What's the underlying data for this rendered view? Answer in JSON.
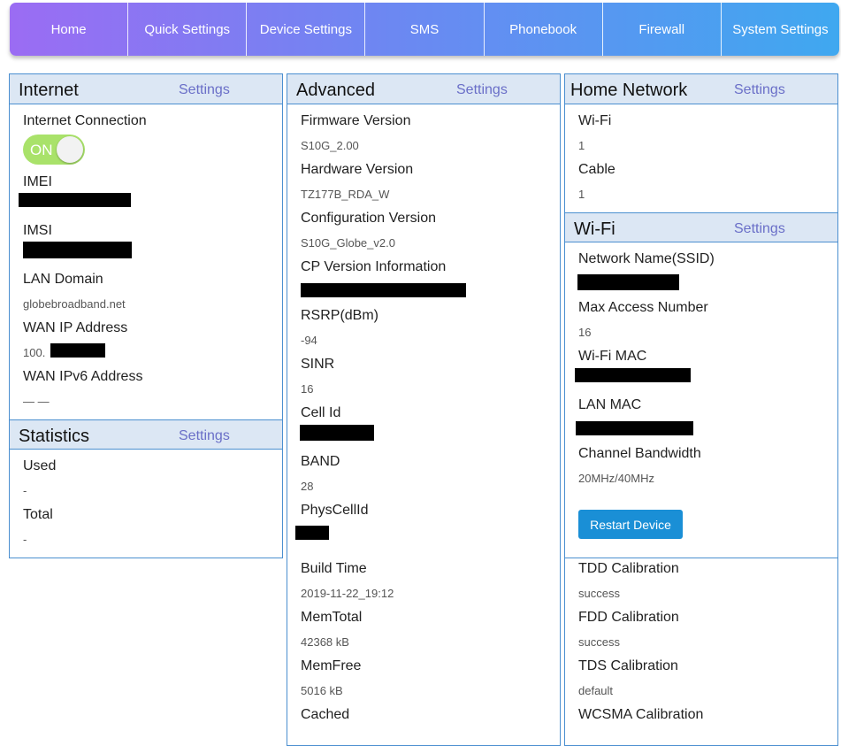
{
  "nav": [
    "Home",
    "Quick Settings",
    "Device Settings",
    "SMS",
    "Phonebook",
    "Firewall",
    "System Settings"
  ],
  "internet": {
    "title": "Internet",
    "settings": "Settings",
    "connection_label": "Internet Connection",
    "toggle": "ON",
    "imei_label": "IMEI",
    "imsi_label": "IMSI",
    "lan_domain_label": "LAN Domain",
    "lan_domain": "globebroadband.net",
    "wan_ip_label": "WAN IP Address",
    "wan_ip_prefix": "100.",
    "wan_ipv6_label": "WAN IPv6 Address",
    "wan_ipv6": "— —"
  },
  "statistics": {
    "title": "Statistics",
    "settings": "Settings",
    "used_label": "Used",
    "used": "-",
    "total_label": "Total",
    "total": "-"
  },
  "advanced": {
    "title": "Advanced",
    "settings": "Settings",
    "items": [
      {
        "label": "Firmware Version",
        "value": "S10G_2.00"
      },
      {
        "label": "Hardware Version",
        "value": "TZ177B_RDA_W"
      },
      {
        "label": "Configuration Version",
        "value": "S10G_Globe_v2.0"
      },
      {
        "label": "CP Version Information",
        "value": ""
      },
      {
        "label": "RSRP(dBm)",
        "value": "-94"
      },
      {
        "label": "SINR",
        "value": "16"
      },
      {
        "label": "Cell Id",
        "value": ""
      },
      {
        "label": "BAND",
        "value": "28"
      },
      {
        "label": "PhysCellId",
        "value": ""
      },
      {
        "label": "Build Time",
        "value": "2019-11-22_19:12"
      },
      {
        "label": "MemTotal",
        "value": "42368 kB"
      },
      {
        "label": "MemFree",
        "value": "5016 kB"
      },
      {
        "label": "Cached",
        "value": ""
      }
    ]
  },
  "home_network": {
    "title": "Home Network",
    "settings": "Settings",
    "wifi_label": "Wi-Fi",
    "wifi": "1",
    "cable_label": "Cable",
    "cable": "1"
  },
  "wifi": {
    "title": "Wi-Fi",
    "settings": "Settings",
    "ssid_label": "Network Name(SSID)",
    "max_label": "Max Access Number",
    "max": "16",
    "mac_label": "Wi-Fi MAC",
    "lan_mac_label": "LAN MAC",
    "bandwidth_label": "Channel Bandwidth",
    "bandwidth": "20MHz/40MHz",
    "restart": "Restart Device"
  },
  "calibration": {
    "tdd_label": "TDD Calibration",
    "tdd": "success",
    "fdd_label": "FDD Calibration",
    "fdd": "success",
    "tds_label": "TDS Calibration",
    "tds": "default",
    "wcsma_label": "WCSMA Calibration"
  }
}
